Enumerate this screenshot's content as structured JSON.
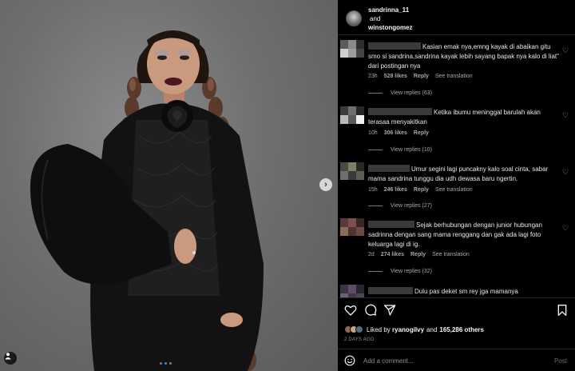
{
  "post": {
    "header": {
      "user1": "sandrinna_11",
      "and_label": "and",
      "user2": "winstongomez"
    },
    "carousel": {
      "next_arrow": "›",
      "dot_count": 3,
      "active_dot": 1
    },
    "comments": [
      {
        "text": "Kasian emak nya,emng kayak di abaikan gitu smo si sandrina,sandrina kayak lebih sayang bapak nya kalo di liat\" dari postingan nya",
        "time": "23h",
        "likes": "528 likes",
        "reply": "Reply",
        "translate": "See translation",
        "view_replies": "View replies (63)",
        "avatar_colors": [
          "#5b5b5b",
          "#8a8a8a",
          "#2e2e2e",
          "#cfcfcf",
          "#9c9c9c",
          "#444"
        ]
      },
      {
        "text": "Ketika ibumu meninggal barulah akan terasaa menyakitkan",
        "time": "10h",
        "likes": "306 likes",
        "reply": "Reply",
        "translate": "",
        "view_replies": "View replies (10)",
        "avatar_colors": [
          "#3b3b3b",
          "#6f6f6f",
          "#262626",
          "#b9b9b9",
          "#5a5a5a",
          "#efefef"
        ]
      },
      {
        "text": "Umur segini lagi puncakny kalo soal cinta, sabar mama sandrina tunggu dia udh dewasa baru ngertin.",
        "time": "15h",
        "likes": "246 likes",
        "reply": "Reply",
        "translate": "See translation",
        "view_replies": "View replies (27)",
        "avatar_colors": [
          "#4c4c3e",
          "#7d8066",
          "#2a2a24",
          "#6e6e6e",
          "#3a3a3a",
          "#5e5e52"
        ]
      },
      {
        "text": "Sejak berhubungan dengan junior hubungan sadrinna dengan sang mama renggang dan gak ada lagi foto keluarga lagi di ig.",
        "time": "2d",
        "likes": "274 likes",
        "reply": "Reply",
        "translate": "See translation",
        "view_replies": "View replies (32)",
        "avatar_colors": [
          "#5a3a3a",
          "#7d5050",
          "#3a2626",
          "#8f6a55",
          "#4e3434",
          "#6c4a44"
        ]
      },
      {
        "text": "Dulu pas deket sm rey jga mamanya",
        "time": "",
        "likes": "",
        "reply": "",
        "translate": "",
        "view_replies": "",
        "avatar_colors": [
          "#3c3344",
          "#5d4e66",
          "#2a2430",
          "#6e6078",
          "#413848",
          "#514458"
        ]
      }
    ],
    "likes": {
      "prefix": "Liked by",
      "user": "ryanogilvy",
      "and_label": "and",
      "others": "165,286 others"
    },
    "timestamp": "2 DAYS AGO",
    "add_comment": {
      "placeholder": "Add a comment...",
      "post_label": "Post"
    },
    "icons": [
      "heart-icon",
      "comment-icon",
      "share-icon",
      "bookmark-icon",
      "emoji-icon",
      "tag-user-icon",
      "more-options-icon"
    ],
    "colors": {
      "accent": "#1e90ff",
      "background": "#000000",
      "meta_text": "#a8a8a8"
    }
  }
}
